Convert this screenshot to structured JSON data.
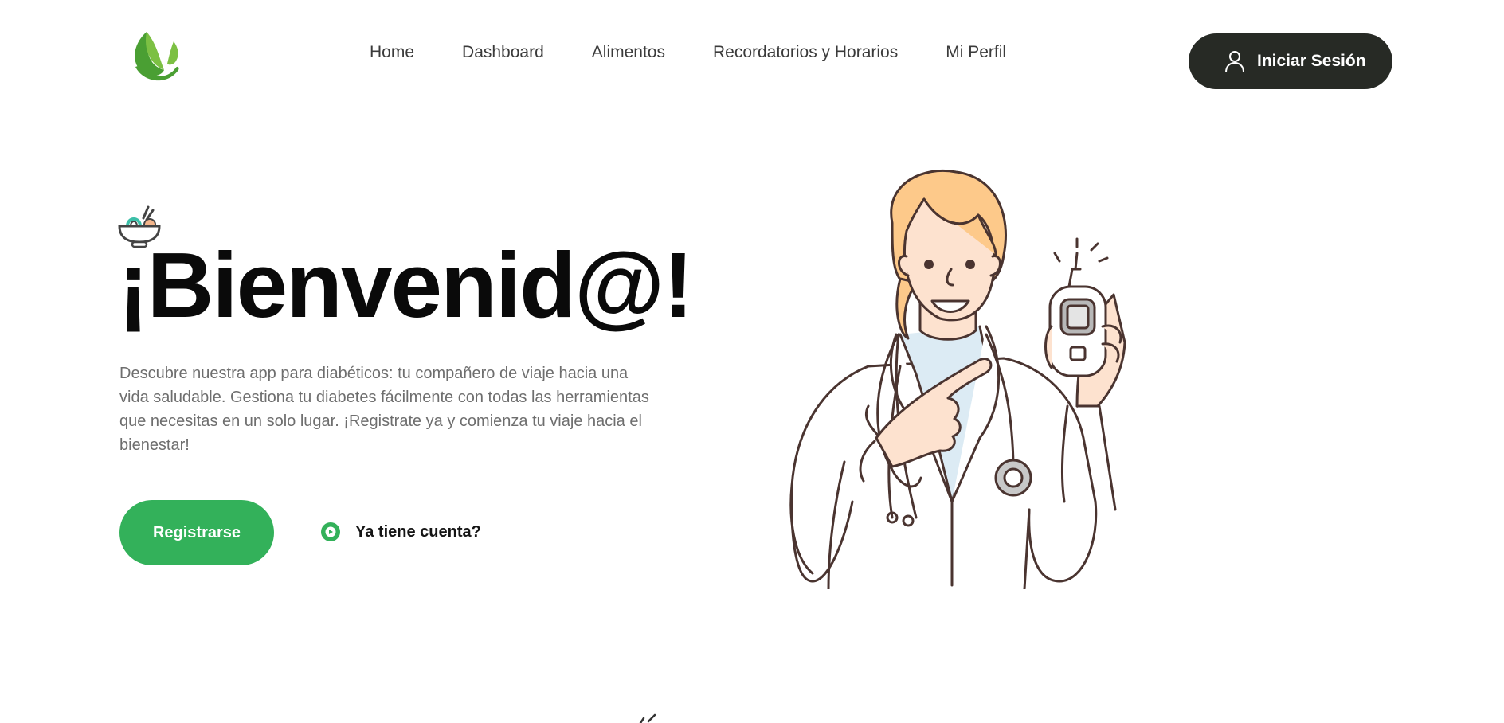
{
  "brand": {
    "logo_icon": "leaf-logo-icon",
    "colors": {
      "leaf_dark": "#3f9a2f",
      "leaf_light": "#7cc043"
    }
  },
  "nav": {
    "items": [
      {
        "label": "Home"
      },
      {
        "label": "Dashboard"
      },
      {
        "label": "Alimentos"
      },
      {
        "label": "Recordatorios y Horarios"
      },
      {
        "label": "Mi Perfil"
      }
    ]
  },
  "header": {
    "login_label": "Iniciar Sesión",
    "login_icon": "user-icon",
    "login_bg": "#272a25"
  },
  "hero": {
    "decor_icon": "food-bowl-icon",
    "title": "¡Bienvenid@!",
    "description": "Descubre nuestra app para diabéticos: tu compañero de viaje hacia una vida saludable. Gestiona tu diabetes fácilmente con todas las herramientas que necesitas en un solo lugar. ¡Registrate ya y comienza tu viaje hacia el bienestar!",
    "register_label": "Registrarse",
    "register_color": "#33b15a",
    "account_label": "Ya tiene cuenta?",
    "account_icon": "play-circle-icon",
    "illustration": "doctor-with-glucometer-illustration"
  }
}
